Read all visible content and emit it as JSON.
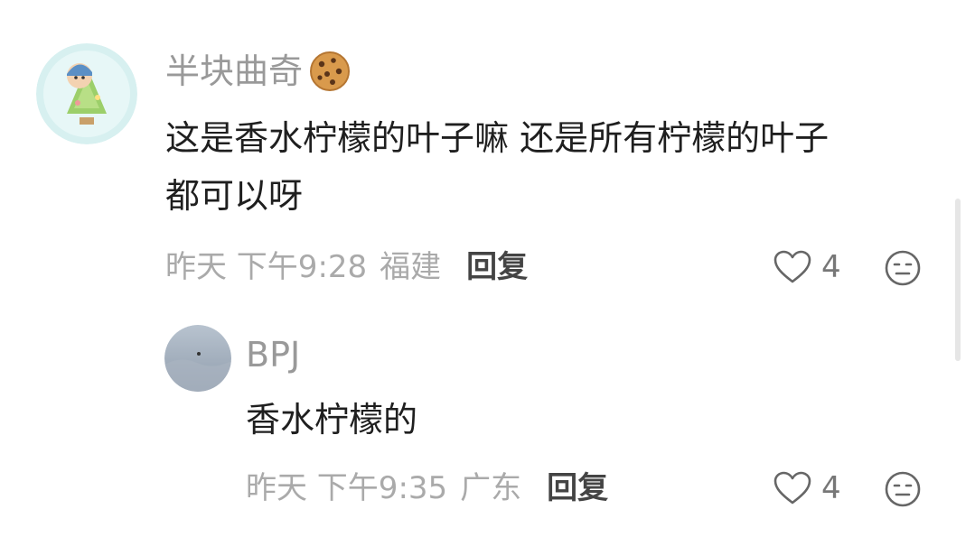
{
  "comments": [
    {
      "username": "半块曲奇",
      "username_emoji": "cookie-icon",
      "text_line1": "这是香水柠檬的叶子嘛 还是所有柠檬的叶子",
      "text_line2": "都可以呀",
      "time": "昨天 下午9:28",
      "location": "福建",
      "reply_label": "回复",
      "likes": "4"
    },
    {
      "username": "BPJ",
      "text": "香水柠檬的",
      "time": "昨天 下午9:35",
      "location": "广东",
      "reply_label": "回复",
      "likes": "4"
    }
  ],
  "colors": {
    "username": "#999999",
    "body_text": "#1f1f1f",
    "meta": "#aaaaaa",
    "reply": "#444444",
    "icon": "#777777"
  }
}
